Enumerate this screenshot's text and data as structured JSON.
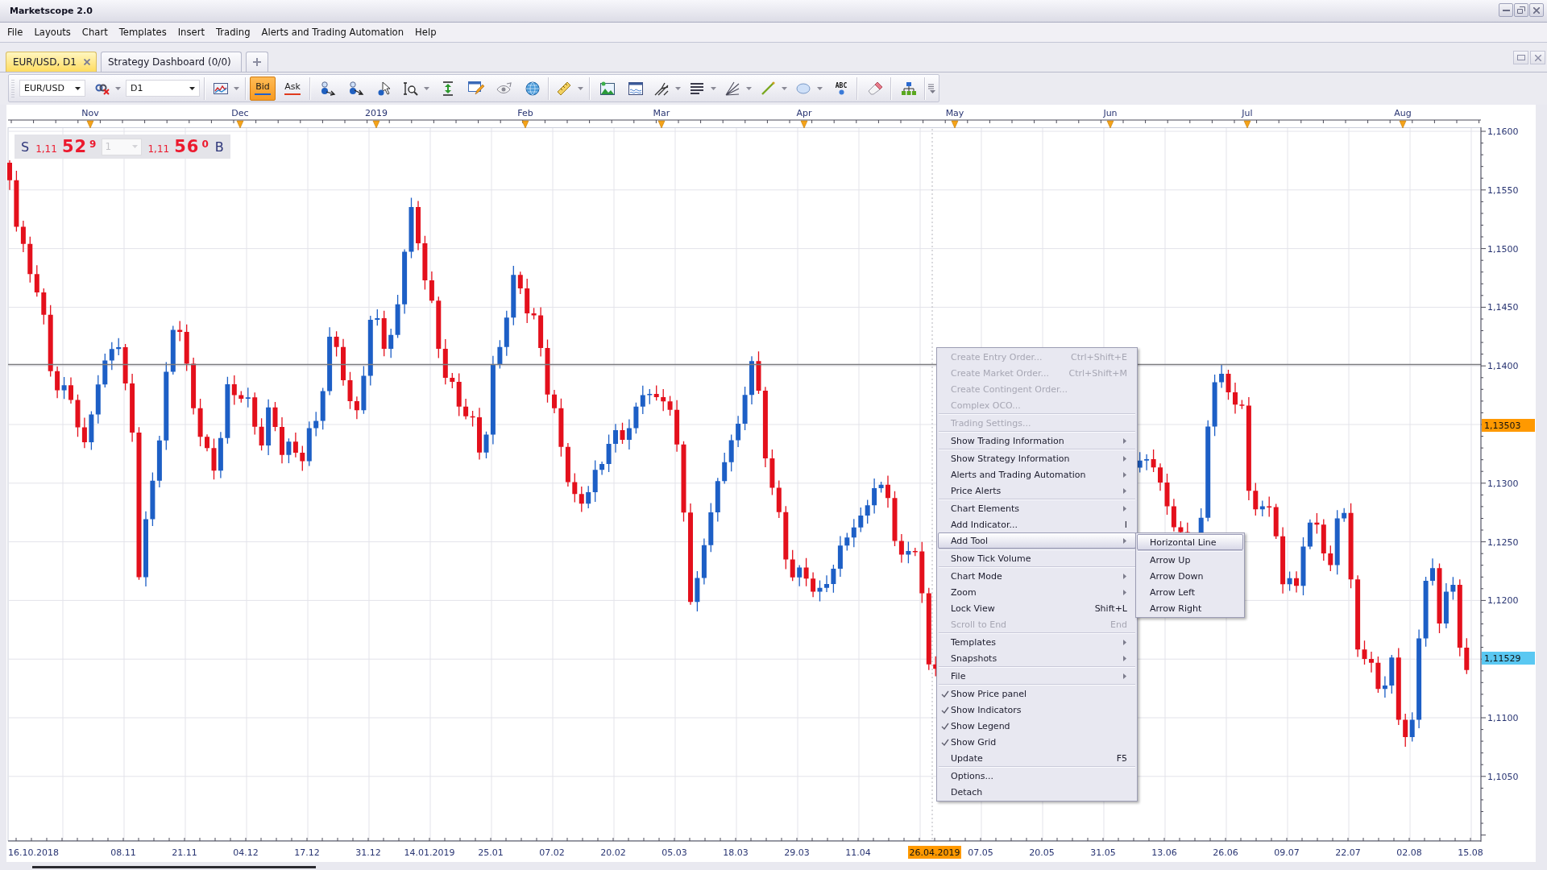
{
  "window": {
    "title": "Marketscope 2.0"
  },
  "menu": [
    "File",
    "Layouts",
    "Chart",
    "Templates",
    "Insert",
    "Trading",
    "Alerts and Trading Automation",
    "Help"
  ],
  "tabs": [
    {
      "label": "EUR/USD, D1",
      "selected": true
    },
    {
      "label": "Strategy Dashboard (0/0)",
      "selected": false
    }
  ],
  "toolbar": {
    "symbol": "EUR/USD",
    "timeframe": "D1",
    "price_sides": [
      {
        "label": "Bid",
        "selected": true,
        "color": "#2060c8"
      },
      {
        "label": "Ask",
        "selected": false,
        "color": "#e03a1e"
      }
    ],
    "text_tool_label": "ABC"
  },
  "chart": {
    "month_labels": [
      "Nov",
      "Dec",
      "2019",
      "Feb",
      "Mar",
      "Apr",
      "May",
      "Jun",
      "Jul",
      "Aug"
    ],
    "price_labels": [
      "1,1600",
      "1,1550",
      "1,1500",
      "1,1450",
      "1,1400",
      "1,1300",
      "1,1250",
      "1,1200",
      "1,1100",
      "1,1050"
    ],
    "price_markers": [
      {
        "text": "1,13503",
        "color": "#ff9900"
      },
      {
        "text": "1,11529",
        "color": "#5ac8f2"
      }
    ],
    "date_labels": [
      "16.10.2018",
      "08.11",
      "21.11",
      "04.12",
      "17.12",
      "31.12",
      "14.01.2019",
      "25.01",
      "07.02",
      "20.02",
      "05.03",
      "18.03",
      "29.03",
      "11.04",
      "07.05",
      "20.05",
      "31.05",
      "13.06",
      "26.06",
      "09.07",
      "22.07",
      "02.08",
      "15.08"
    ],
    "cursor_date": "26.04.2019"
  },
  "price_panel": {
    "sell": {
      "label": "S",
      "prefix": "1,11",
      "pips": "52",
      "fraction": "9"
    },
    "amount": "1",
    "buy": {
      "label": "B",
      "prefix": "1,11",
      "pips": "56",
      "fraction": "0"
    }
  },
  "context_menu": {
    "sections": [
      {
        "items": [
          {
            "label": "Create Entry Order...",
            "shortcut": "Ctrl+Shift+E",
            "disabled": true,
            "checked": false,
            "selected": false,
            "submenu": false
          },
          {
            "label": "Create Market Order...",
            "shortcut": "Ctrl+Shift+M",
            "disabled": true,
            "checked": false,
            "selected": false,
            "submenu": false
          },
          {
            "label": "Create Contingent Order...",
            "disabled": true,
            "checked": false,
            "selected": false,
            "submenu": false
          },
          {
            "label": "Complex OCO...",
            "disabled": true,
            "checked": false,
            "selected": false,
            "submenu": false
          }
        ]
      },
      {
        "items": [
          {
            "label": "Trading Settings...",
            "disabled": true,
            "checked": false,
            "selected": false,
            "submenu": false
          }
        ]
      },
      {
        "items": [
          {
            "label": "Show Trading Information",
            "disabled": false,
            "checked": false,
            "selected": false,
            "submenu": true
          }
        ]
      },
      {
        "items": [
          {
            "label": "Show Strategy Information",
            "disabled": false,
            "checked": false,
            "selected": false,
            "submenu": true
          },
          {
            "label": "Alerts and Trading Automation",
            "disabled": false,
            "checked": false,
            "selected": false,
            "submenu": true
          },
          {
            "label": "Price Alerts",
            "disabled": false,
            "checked": false,
            "selected": false,
            "submenu": true
          }
        ]
      },
      {
        "items": [
          {
            "label": "Chart Elements",
            "disabled": false,
            "checked": false,
            "selected": false,
            "submenu": true
          },
          {
            "label": "Add Indicator...",
            "shortcut": "I",
            "disabled": false,
            "checked": false,
            "selected": false,
            "submenu": false
          },
          {
            "label": "Add Tool",
            "disabled": false,
            "checked": false,
            "selected": true,
            "submenu": true
          }
        ]
      },
      {
        "items": [
          {
            "label": "Show Tick Volume",
            "disabled": false,
            "checked": false,
            "selected": false,
            "submenu": false
          }
        ]
      },
      {
        "items": [
          {
            "label": "Chart Mode",
            "disabled": false,
            "checked": false,
            "selected": false,
            "submenu": true
          },
          {
            "label": "Zoom",
            "disabled": false,
            "checked": false,
            "selected": false,
            "submenu": true
          },
          {
            "label": "Lock View",
            "shortcut": "Shift+L",
            "disabled": false,
            "checked": false,
            "selected": false,
            "submenu": false
          },
          {
            "label": "Scroll to End",
            "shortcut": "End",
            "disabled": true,
            "checked": false,
            "selected": false,
            "submenu": false
          }
        ]
      },
      {
        "items": [
          {
            "label": "Templates",
            "disabled": false,
            "checked": false,
            "selected": false,
            "submenu": true
          },
          {
            "label": "Snapshots",
            "disabled": false,
            "checked": false,
            "selected": false,
            "submenu": true
          }
        ]
      },
      {
        "items": [
          {
            "label": "File",
            "disabled": false,
            "checked": false,
            "selected": false,
            "submenu": true
          }
        ]
      },
      {
        "items": [
          {
            "label": "Show Price panel",
            "disabled": false,
            "checked": true,
            "selected": false,
            "submenu": false
          },
          {
            "label": "Show Indicators",
            "disabled": false,
            "checked": true,
            "selected": false,
            "submenu": false
          },
          {
            "label": "Show Legend",
            "disabled": false,
            "checked": true,
            "selected": false,
            "submenu": false
          },
          {
            "label": "Show Grid",
            "disabled": false,
            "checked": true,
            "selected": false,
            "submenu": false
          },
          {
            "label": "Update",
            "shortcut": "F5",
            "disabled": false,
            "checked": false,
            "selected": false,
            "submenu": false
          }
        ]
      },
      {
        "items": [
          {
            "label": "Options...",
            "disabled": false,
            "checked": false,
            "selected": false,
            "submenu": false
          },
          {
            "label": "Detach",
            "disabled": false,
            "checked": false,
            "selected": false,
            "submenu": false
          }
        ]
      }
    ]
  },
  "submenu": {
    "sections": [
      {
        "items": [
          {
            "label": "Horizontal Line",
            "selected": true
          }
        ]
      },
      {
        "items": [
          {
            "label": "Arrow Up",
            "selected": false
          },
          {
            "label": "Arrow Down",
            "selected": false
          },
          {
            "label": "Arrow Left",
            "selected": false
          },
          {
            "label": "Arrow Right",
            "selected": false
          }
        ]
      }
    ]
  }
}
